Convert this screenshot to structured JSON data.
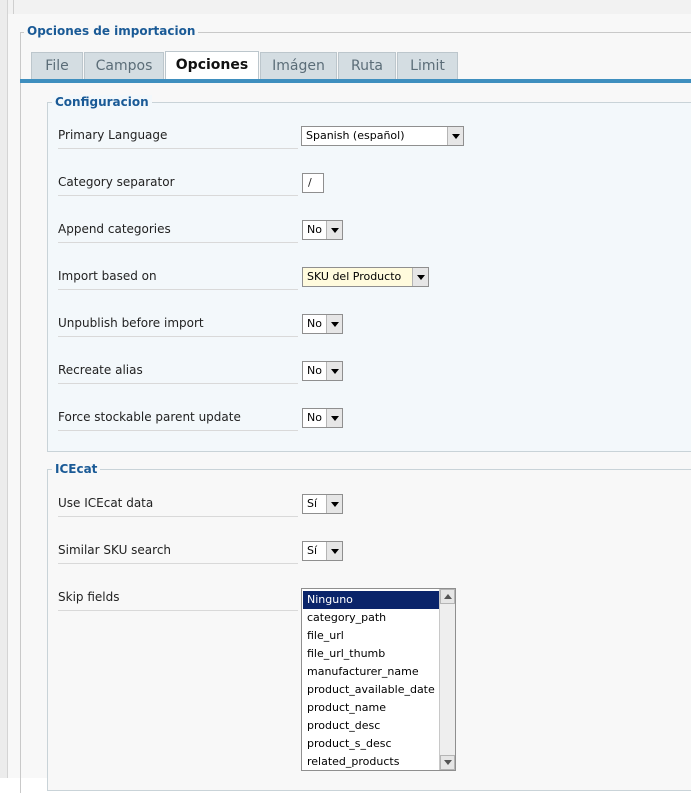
{
  "panel": {
    "title": "Opciones de importacion"
  },
  "tabs": [
    {
      "label": "File"
    },
    {
      "label": "Campos"
    },
    {
      "label": "Opciones"
    },
    {
      "label": "Imágen"
    },
    {
      "label": "Ruta"
    },
    {
      "label": "Limit"
    }
  ],
  "active_tab": "Opciones",
  "config": {
    "legend": "Configuracion",
    "primary_language": {
      "label": "Primary Language",
      "value": "Spanish (español)"
    },
    "category_separator": {
      "label": "Category separator",
      "value": "/"
    },
    "append_categories": {
      "label": "Append categories",
      "value": "No"
    },
    "import_based_on": {
      "label": "Import based on",
      "value": "SKU del Producto"
    },
    "unpublish_before_import": {
      "label": "Unpublish before import",
      "value": "No"
    },
    "recreate_alias": {
      "label": "Recreate alias",
      "value": "No"
    },
    "force_stockable": {
      "label": "Force stockable parent update",
      "value": "No"
    }
  },
  "icecat": {
    "legend": "ICEcat",
    "use_icecat": {
      "label": "Use ICEcat data",
      "value": "Sí"
    },
    "similar_sku": {
      "label": "Similar SKU search",
      "value": "Sí"
    },
    "skip_fields": {
      "label": "Skip fields",
      "options": [
        "Ninguno",
        "category_path",
        "file_url",
        "file_url_thumb",
        "manufacturer_name",
        "product_available_date",
        "product_name",
        "product_desc",
        "product_s_desc",
        "related_products"
      ],
      "selected": "Ninguno"
    }
  },
  "colors": {
    "accent": "#3f8fbf",
    "legend": "#1a5a96",
    "selection": "#0a246a"
  }
}
